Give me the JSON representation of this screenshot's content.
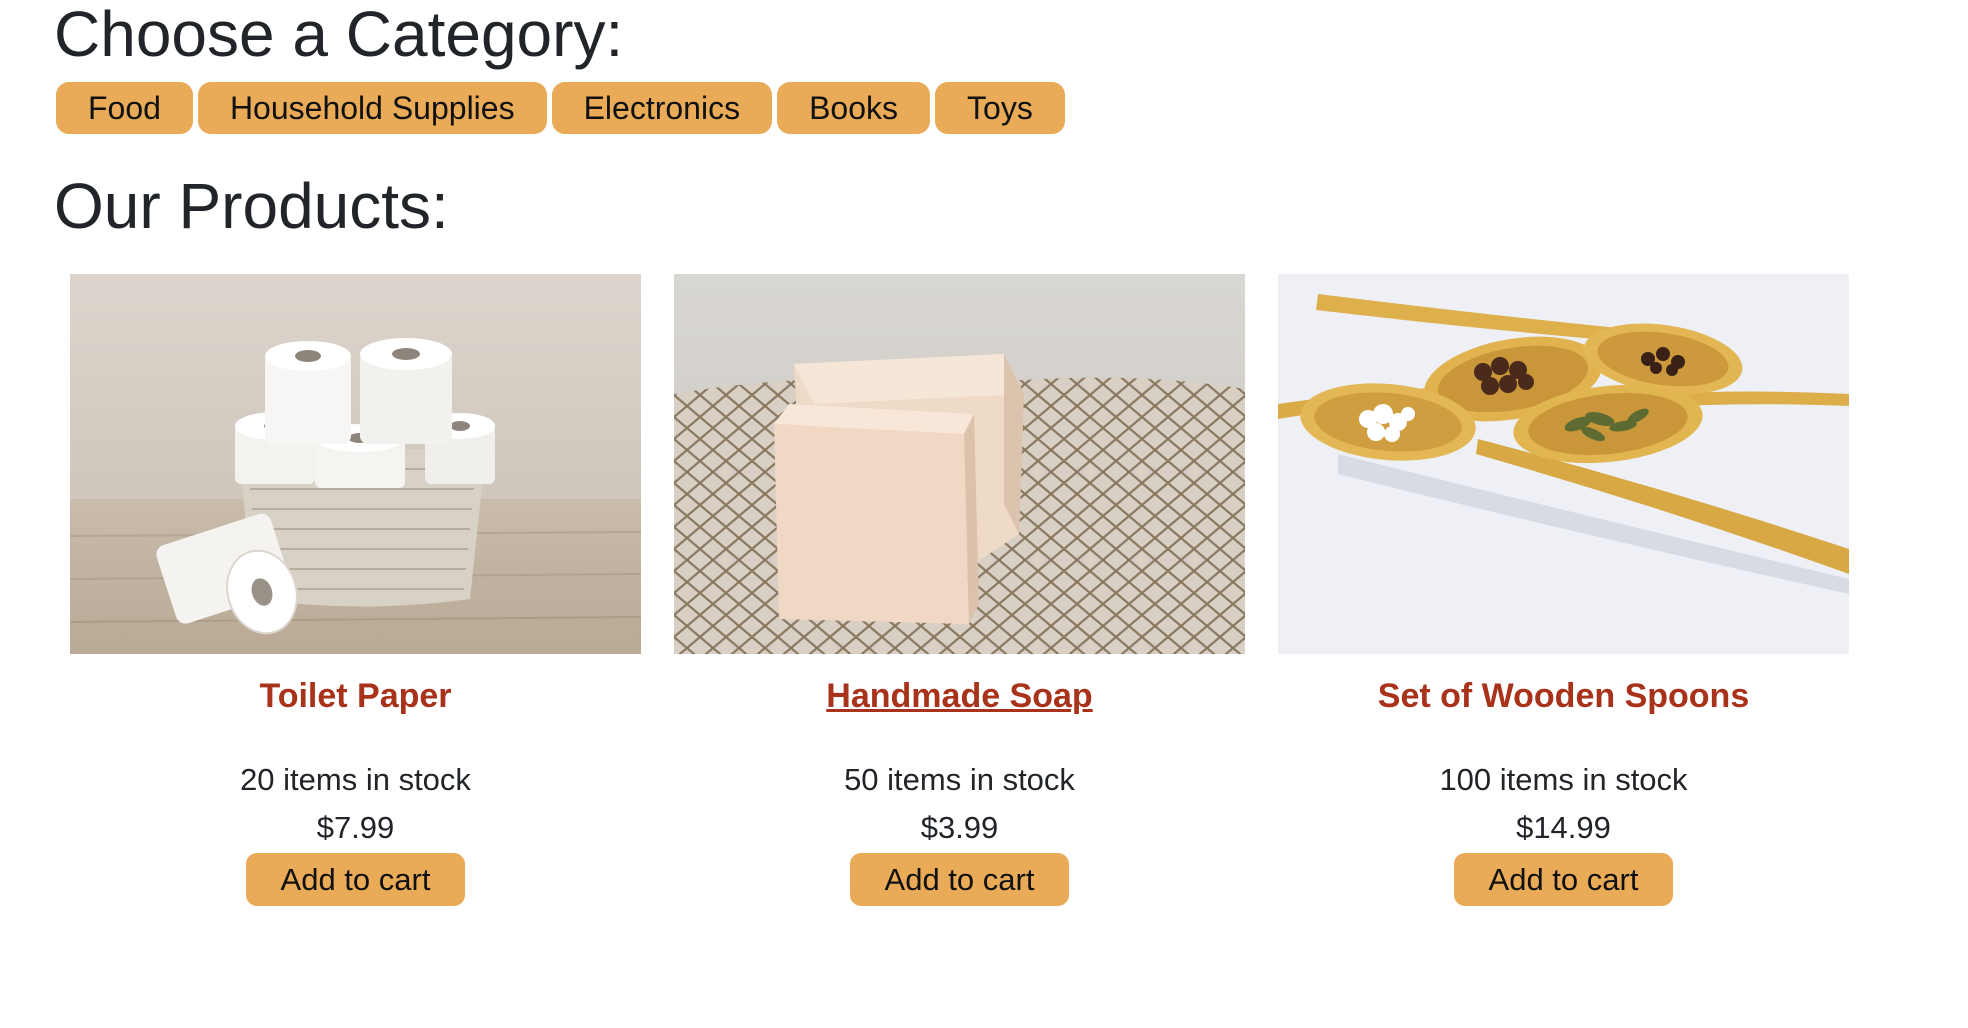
{
  "categories": {
    "heading": "Choose a Category:",
    "items": [
      "Food",
      "Household Supplies",
      "Electronics",
      "Books",
      "Toys"
    ]
  },
  "products": {
    "heading": "Our Products:",
    "items": [
      {
        "name": "Toilet Paper",
        "stock": "20 items in stock",
        "price": "$7.99",
        "button": "Add to cart",
        "image": "toilet-paper-photo"
      },
      {
        "name": "Handmade Soap",
        "stock": "50 items in stock",
        "price": "$3.99",
        "button": "Add to cart",
        "image": "handmade-soap-photo"
      },
      {
        "name": "Set of Wooden Spoons",
        "stock": "100 items in stock",
        "price": "$14.99",
        "button": "Add to cart",
        "image": "wooden-spoons-photo"
      }
    ]
  },
  "colors": {
    "button": "#e9ab57",
    "product_title": "#a8321a",
    "text": "#212529"
  }
}
